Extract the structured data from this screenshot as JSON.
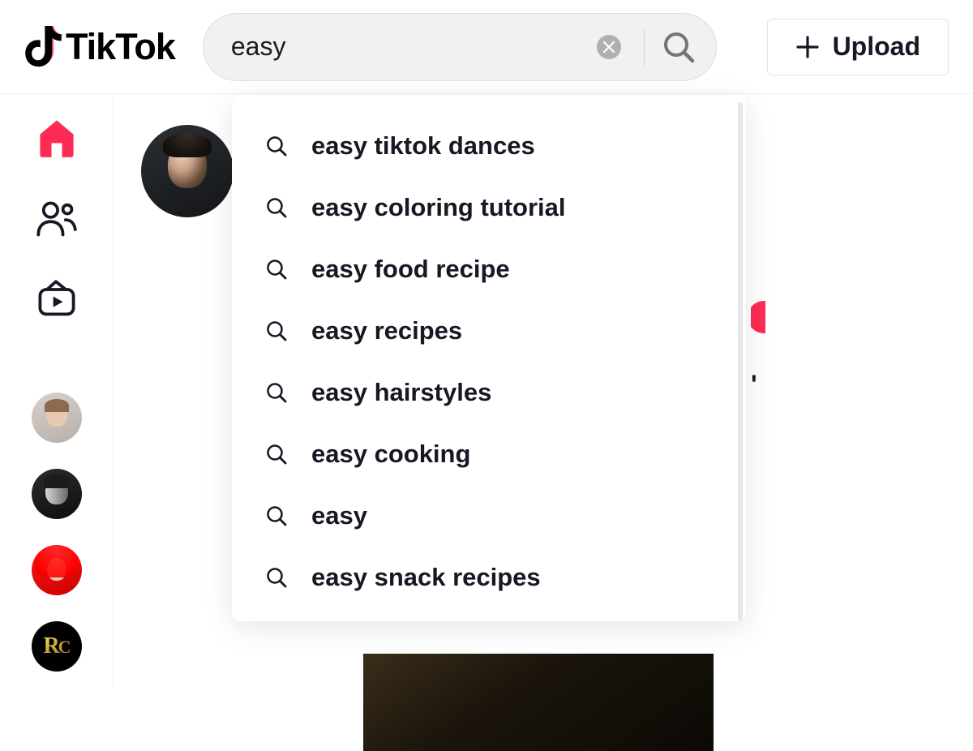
{
  "header": {
    "brand": "TikTok",
    "search_value": "easy",
    "upload_label": "Upload"
  },
  "search_suggestions": [
    "easy tiktok dances",
    "easy coloring tutorial",
    "easy food recipe",
    "easy recipes",
    "easy hairstyles",
    "easy cooking",
    "easy",
    "easy snack recipes"
  ],
  "sidebar": {
    "nav": [
      {
        "id": "for-you",
        "active": true
      },
      {
        "id": "following",
        "active": false
      },
      {
        "id": "live",
        "active": false
      }
    ],
    "suggested_accounts_count": 4
  },
  "icons": {
    "home_color": "#fe2c55",
    "inactive_color": "#161823"
  }
}
